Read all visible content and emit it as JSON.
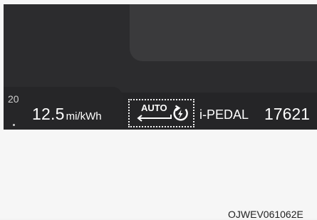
{
  "cluster": {
    "gauge_value": "20",
    "efficiency_value": "12.5",
    "efficiency_unit": "mi/kWh",
    "regen_mode_label": "AUTO",
    "ipedal_label": "i-PEDAL",
    "odometer_value": "17621"
  },
  "figure": {
    "code": "OJWEV061062E"
  },
  "icons": {
    "regen": "regen-lightning-icon",
    "auto_arrow": "auto-arrow-icon"
  },
  "colors": {
    "screen_bg": "#2c2c2e",
    "text": "#ffffff",
    "dotted_highlight": "#f0f0f0"
  }
}
